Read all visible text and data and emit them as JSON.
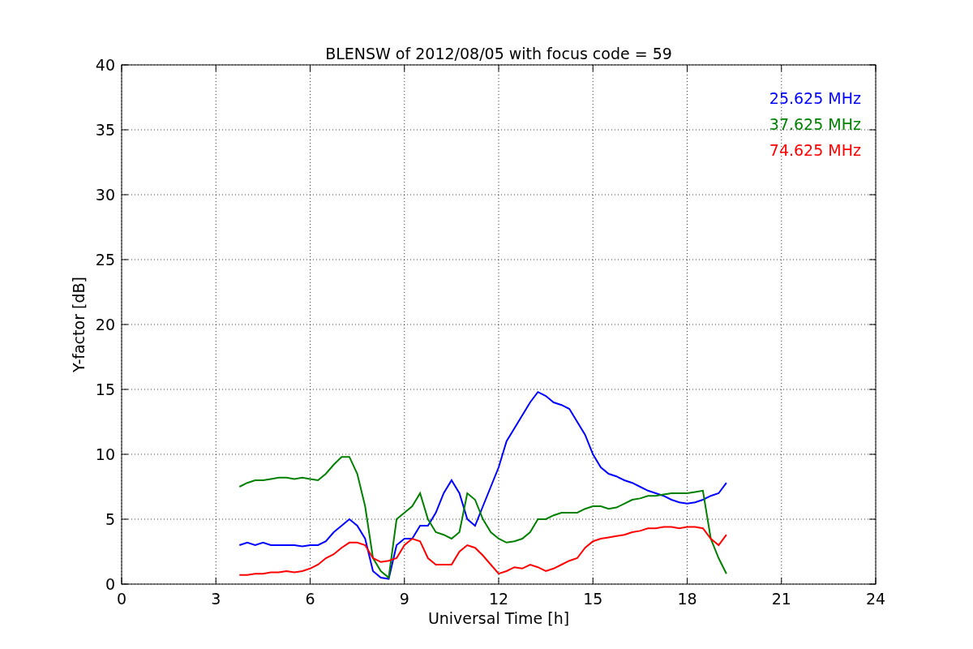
{
  "figure": {
    "chart_data": {
      "type": "line",
      "title": "BLENSW of 2012/08/05 with focus code = 59",
      "xlabel": "Universal Time [h]",
      "ylabel": "Y-factor [dB]",
      "x": [
        3.75,
        4,
        4.25,
        4.5,
        4.75,
        5,
        5.25,
        5.5,
        5.75,
        6,
        6.25,
        6.5,
        6.75,
        7,
        7.25,
        7.5,
        7.75,
        8,
        8.25,
        8.5,
        8.75,
        9,
        9.25,
        9.5,
        9.75,
        10,
        10.25,
        10.5,
        10.75,
        11,
        11.25,
        11.5,
        11.75,
        12,
        12.25,
        12.5,
        12.75,
        13,
        13.25,
        13.5,
        13.75,
        14,
        14.25,
        14.5,
        14.75,
        15,
        15.25,
        15.5,
        15.75,
        16,
        16.25,
        16.5,
        16.75,
        17,
        17.25,
        17.5,
        17.75,
        18,
        18.25,
        18.5,
        18.75,
        19,
        19.25
      ],
      "series": [
        {
          "name": "25.625 MHz",
          "color": "#0000ff",
          "values": [
            3,
            3.2,
            3,
            3.2,
            3,
            3,
            3,
            3,
            2.9,
            3,
            3,
            3.3,
            4,
            4.5,
            5,
            4.5,
            3.5,
            1,
            0.5,
            0.4,
            3,
            3.5,
            3.5,
            4.5,
            4.5,
            5.5,
            7,
            8,
            7,
            5,
            4.5,
            6,
            7.5,
            9,
            11,
            12,
            13,
            14,
            14.8,
            14.5,
            14,
            13.8,
            13.5,
            12.5,
            11.5,
            10,
            9,
            8.5,
            8.3,
            8,
            7.8,
            7.5,
            7.2,
            7,
            6.8,
            6.5,
            6.3,
            6.2,
            6.3,
            6.5,
            6.8,
            7,
            7.8
          ]
        },
        {
          "name": "37.625 MHz",
          "color": "#008000",
          "values": [
            7.5,
            7.8,
            8,
            8,
            8.1,
            8.2,
            8.2,
            8.1,
            8.2,
            8.1,
            8,
            8.5,
            9.2,
            9.8,
            9.8,
            8.5,
            6,
            2,
            1,
            0.5,
            5,
            5.5,
            6,
            7,
            5,
            4,
            3.8,
            3.5,
            4,
            7,
            6.5,
            5,
            4,
            3.5,
            3.2,
            3.3,
            3.5,
            4,
            5,
            5,
            5.3,
            5.5,
            5.5,
            5.5,
            5.8,
            6,
            6,
            5.8,
            5.9,
            6.2,
            6.5,
            6.6,
            6.8,
            6.8,
            6.9,
            7,
            7,
            7,
            7.1,
            7.2,
            3.5,
            2,
            0.8
          ]
        },
        {
          "name": "74.625 MHz",
          "color": "#ff0000",
          "values": [
            0.7,
            0.7,
            0.8,
            0.8,
            0.9,
            0.9,
            1,
            0.9,
            1,
            1.2,
            1.5,
            2,
            2.3,
            2.8,
            3.2,
            3.2,
            3,
            2,
            1.7,
            1.8,
            2,
            3,
            3.5,
            3.3,
            2,
            1.5,
            1.5,
            1.5,
            2.5,
            3,
            2.8,
            2.2,
            1.5,
            0.8,
            1,
            1.3,
            1.2,
            1.5,
            1.3,
            1,
            1.2,
            1.5,
            1.8,
            2,
            2.8,
            3.3,
            3.5,
            3.6,
            3.7,
            3.8,
            4,
            4.1,
            4.3,
            4.3,
            4.4,
            4.4,
            4.3,
            4.4,
            4.4,
            4.3,
            3.5,
            3,
            3.8
          ]
        }
      ],
      "grid": true,
      "xlim": [
        0,
        24
      ],
      "ylim": [
        0,
        40
      ],
      "xticks": [
        0,
        3,
        6,
        9,
        12,
        15,
        18,
        21,
        24
      ],
      "yticks": [
        0,
        5,
        10,
        15,
        20,
        25,
        30,
        35,
        40
      ]
    }
  }
}
